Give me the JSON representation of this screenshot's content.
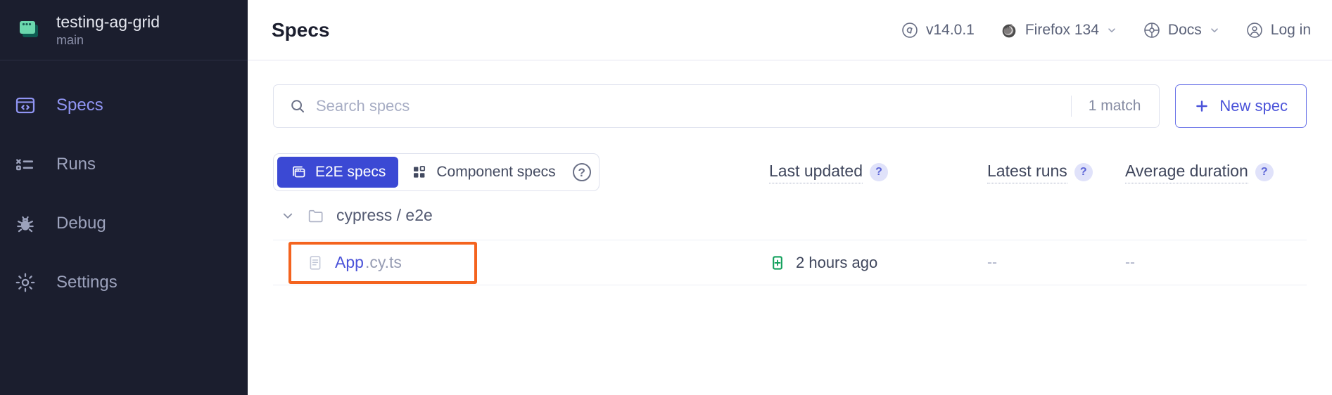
{
  "sidebar": {
    "project": {
      "name": "testing-ag-grid",
      "branch": "main",
      "logo_icon": "stacked-windows-logo"
    },
    "items": [
      {
        "label": "Specs",
        "icon": "code-window-icon",
        "active": true
      },
      {
        "label": "Runs",
        "icon": "test-results-list-icon",
        "active": false
      },
      {
        "label": "Debug",
        "icon": "bug-icon",
        "active": false
      },
      {
        "label": "Settings",
        "icon": "gear-icon",
        "active": false
      }
    ]
  },
  "topbar": {
    "title": "Specs",
    "version": {
      "label": "v14.0.1",
      "icon": "cypress-logo-icon"
    },
    "browser": {
      "label": "Firefox 134",
      "icon": "firefox-icon",
      "caret": "chevron-down-icon"
    },
    "docs": {
      "label": "Docs",
      "icon": "docs-globe-icon",
      "caret": "chevron-down-icon"
    },
    "login": {
      "label": "Log in",
      "icon": "user-circle-icon"
    }
  },
  "search": {
    "placeholder": "Search specs",
    "value": "",
    "icon": "search-icon",
    "match_count": "1 match"
  },
  "new_spec_button": {
    "label": "New spec",
    "icon": "plus-icon"
  },
  "tabs": [
    {
      "label": "E2E specs",
      "icon": "browser-stack-icon",
      "active": true
    },
    {
      "label": "Component specs",
      "icon": "component-blocks-icon",
      "active": false
    }
  ],
  "tabs_help_icon": "question-mark-icon",
  "columns": [
    {
      "label": "Last updated",
      "help_icon": "question-mark-icon"
    },
    {
      "label": "Latest runs",
      "help_icon": "question-mark-icon"
    },
    {
      "label": "Average duration",
      "help_icon": "question-mark-icon"
    }
  ],
  "folder": {
    "label": "cypress / e2e",
    "icon": "folder-icon",
    "chevron": "chevron-down-icon",
    "expanded": true
  },
  "specs": [
    {
      "basename": "App",
      "extension": ".cy.ts",
      "file_icon": "document-icon",
      "status_icon": "file-added-green-icon",
      "last_updated": "2 hours ago",
      "latest_runs": "--",
      "average_duration": "--",
      "highlighted": true
    }
  ],
  "colors": {
    "sidebar_bg": "#1B1E2E",
    "accent_indigo": "#4B53D9",
    "tab_active_blue": "#3B49D4",
    "active_nav": "#9095F3",
    "logo_green": "#6BD8AE",
    "highlight_orange": "#F4631E",
    "status_green": "#12A05C"
  }
}
